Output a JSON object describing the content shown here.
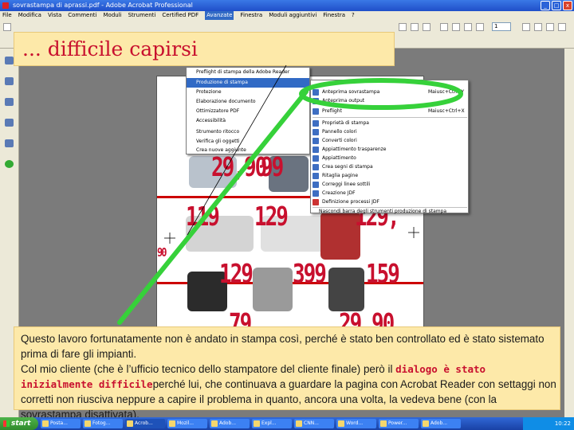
{
  "window": {
    "title": "sovrastampa di aprassi.pdf - Adobe Acrobat Professional",
    "controls": [
      "_",
      "□",
      "x"
    ]
  },
  "menubar": {
    "items": [
      "File",
      "Modifica",
      "Vista",
      "Commenti",
      "Moduli",
      "Strumenti",
      "Certified PDF",
      "Avanzate",
      "Finestra",
      "Moduli aggiuntivi",
      "Finestra",
      "?"
    ],
    "active_index": 7
  },
  "toolbar": {
    "page_number": "1"
  },
  "title_box": {
    "text": "... difficile capirsi"
  },
  "menu_avanzate": {
    "items": [
      "Preflight di stampa della Adobe Reader",
      "Produzione di stampa",
      "Protezione",
      "Elaborazione documento",
      "Ottimizzatore PDF",
      "Accessibilità",
      "Strumento ritocco",
      "Verifica gli oggetti",
      "Crea nuove aggiunte"
    ],
    "highlighted_index": 1
  },
  "submenu_produzione": {
    "items": [
      {
        "label": "Anteprima sovrastampa",
        "shortcut": "Maiusc+Ctrl+Y"
      },
      {
        "label": "Anteprima output",
        "shortcut": ""
      },
      {
        "label": "Preflight",
        "shortcut": "Maiusc+Ctrl+X"
      },
      {
        "label": "Proprietà di stampa",
        "shortcut": ""
      },
      {
        "label": "Pannello colori",
        "shortcut": ""
      },
      {
        "label": "Converti colori",
        "shortcut": ""
      },
      {
        "label": "Appiattimento trasparenze",
        "shortcut": ""
      },
      {
        "label": "Appiattimento",
        "shortcut": ""
      },
      {
        "label": "Crea segni di stampa",
        "shortcut": ""
      },
      {
        "label": "Ritaglia pagine",
        "shortcut": ""
      },
      {
        "label": "Correggi linee sottili",
        "shortcut": ""
      },
      {
        "label": "Creazione JDF",
        "shortcut": ""
      },
      {
        "label": "Definizione processi JDF",
        "shortcut": ""
      },
      {
        "label": "Nascondi barra degli strumenti produzione di stampa",
        "shortcut": ""
      }
    ],
    "highlighted_index": 0
  },
  "prices": [
    "29,90",
    "99",
    "119",
    "129",
    "129,",
    "129",
    "399",
    "159",
    "79",
    "29,90",
    "90"
  ],
  "colors": {
    "accent_red": "#c8102e",
    "note_bg": "#fde9a9",
    "highlight_green": "#36d13a",
    "menu_highlight": "#316ac5"
  },
  "note": {
    "p1": "Questo lavoro fortunatamente non è andato in stampa così, perché è stato ben controllato ed è stato sistemato prima di fare gli impianti.",
    "p2a": "Col mio cliente (che è l’ufficio tecnico dello stampatore del cliente finale) però il ",
    "p2b": "dialogo è stato inizialmente difficile",
    "p2c": "perché lui, che continuava a guardare la pagina con Acrobat Reader con settaggi non corretti  non riusciva neppure a capire il problema in quanto, ancora una volta, la vedeva bene (con la sovrastampa disattivata)."
  },
  "taskbar": {
    "start_label": "start",
    "tasks": [
      "Posta...",
      "Fotog...",
      "Acrob...",
      "Mozil...",
      "Adob...",
      "Expl...",
      "CNN...",
      "Word...",
      "Power...",
      "Adob..."
    ],
    "active_task_index": 2,
    "clock": "10:22"
  }
}
